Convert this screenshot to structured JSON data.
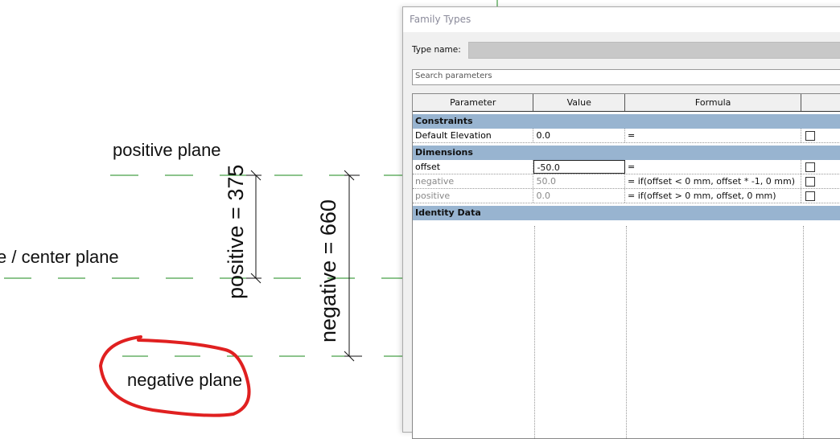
{
  "canvas": {
    "labels": {
      "positive_plane": "positive plane",
      "center_plane": "e / center plane",
      "negative_plane": "negative plane",
      "positive_dim": "positive = 375",
      "negative_dim": "negative = 660"
    },
    "colors": {
      "ref_plane": "#1a8a1a",
      "annotation": "#e02020"
    }
  },
  "dialog": {
    "title": "Family Types",
    "type_name_label": "Type name:",
    "type_name_value": "",
    "search_placeholder": "Search parameters",
    "columns": [
      "Parameter",
      "Value",
      "Formula",
      ""
    ],
    "groups": [
      {
        "name": "Constraints",
        "rows": [
          {
            "parameter": "Default Elevation",
            "value": "0.0",
            "formula": "=",
            "locked": false,
            "dimmed": false
          }
        ]
      },
      {
        "name": "Dimensions",
        "rows": [
          {
            "parameter": "offset",
            "value": "-50.0",
            "formula": "=",
            "locked": false,
            "dimmed": false,
            "editing": true
          },
          {
            "parameter": "negative",
            "value": "50.0",
            "formula": "= if(offset < 0 mm, offset * -1, 0 mm)",
            "locked": false,
            "dimmed": true
          },
          {
            "parameter": "positive",
            "value": "0.0",
            "formula": "= if(offset > 0 mm, offset, 0 mm)",
            "locked": false,
            "dimmed": true
          }
        ]
      },
      {
        "name": "Identity Data",
        "rows": []
      }
    ]
  }
}
